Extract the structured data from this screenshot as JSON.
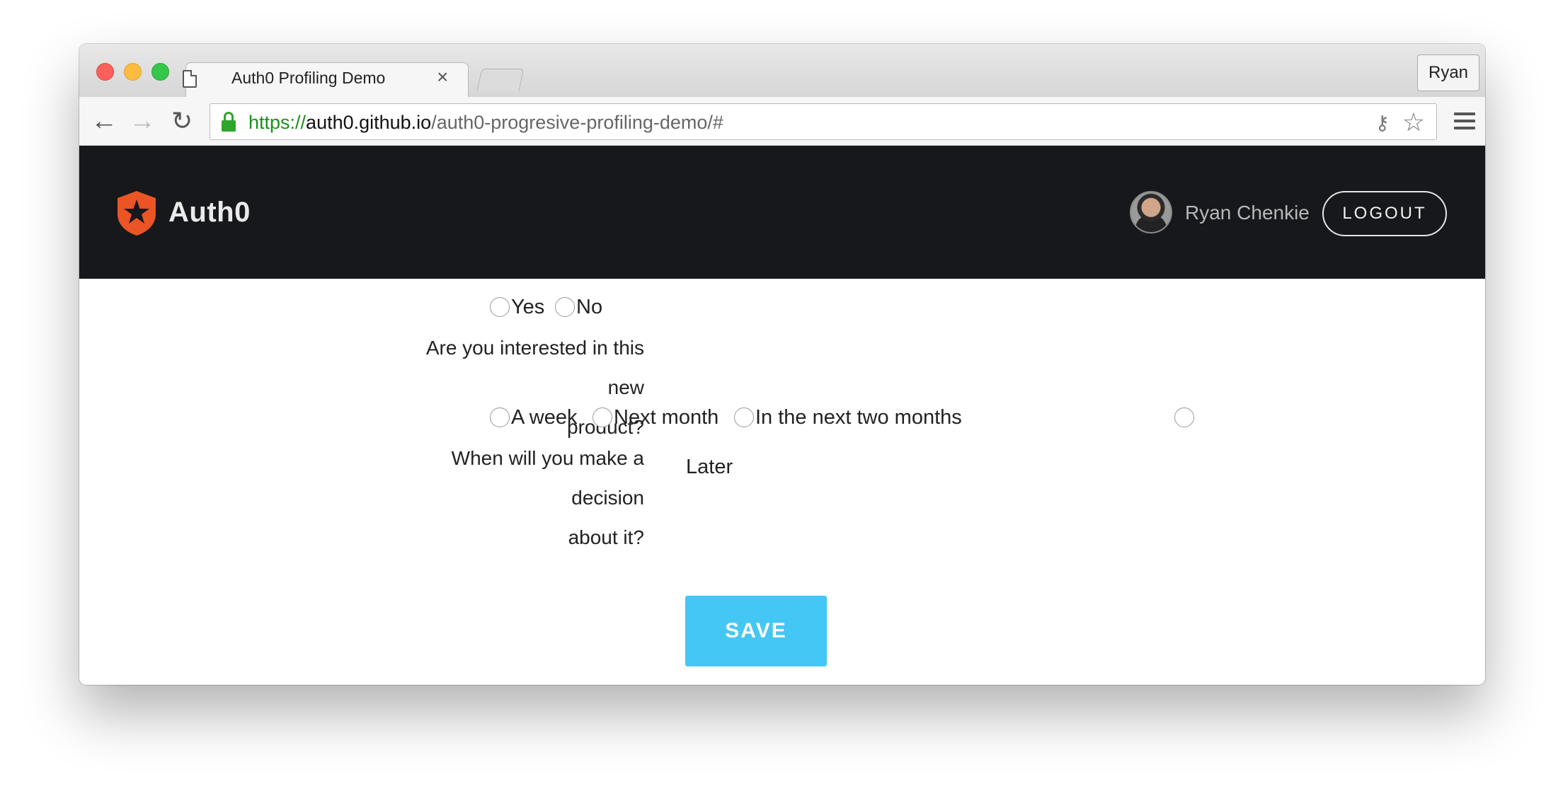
{
  "browser": {
    "tab_title": "Auth0 Profiling Demo",
    "tab_close": "×",
    "profile_name": "Ryan",
    "url": {
      "scheme": "https://",
      "host": "auth0.github.io",
      "path": "/auth0-progresive-profiling-demo/#"
    }
  },
  "header": {
    "logo_text": "Auth0",
    "user_name": "Ryan Chenkie",
    "logout_label": "LOGOUT",
    "brand_color": "#eb5424",
    "background_color": "#16181c"
  },
  "form": {
    "q1": {
      "line1": "Are you interested in this new",
      "line2": "product?",
      "options": [
        "Yes",
        "No"
      ]
    },
    "q2": {
      "line1": "When will you make a decision",
      "line2": "about it?",
      "options": [
        "A week",
        "Next month",
        "In the next two months",
        "Later"
      ]
    },
    "save_label": "SAVE",
    "save_color": "#44c7f4"
  },
  "icons": {
    "back": "←",
    "forward": "→",
    "reload": "↻",
    "star": "☆",
    "key": "⚷"
  }
}
